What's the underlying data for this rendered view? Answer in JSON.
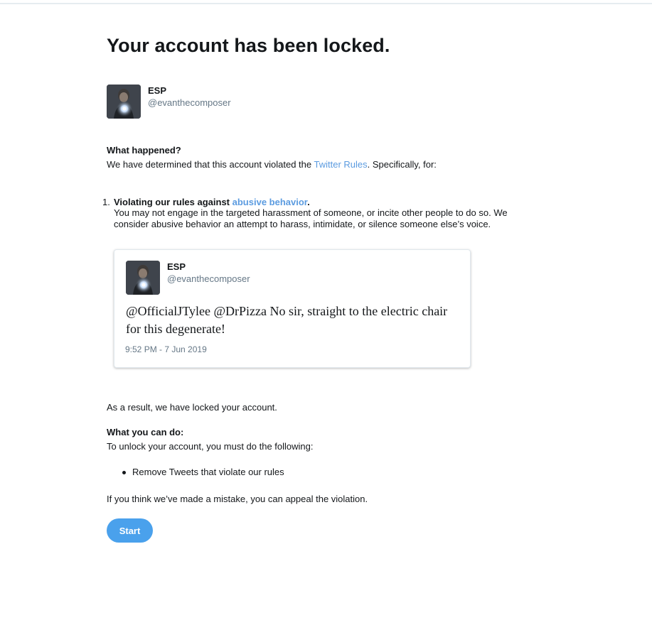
{
  "page": {
    "title": "Your account has been locked."
  },
  "account": {
    "name": "ESP",
    "handle": "@evanthecomposer"
  },
  "what_happened": {
    "heading": "What happened?",
    "text_before_link": "We have determined that this account violated the ",
    "rules_link": "Twitter Rules",
    "text_after_link": ". Specifically, for:"
  },
  "violations": [
    {
      "number": "1.",
      "title_prefix": "Violating our rules against ",
      "title_link": "abusive behavior",
      "title_suffix": ".",
      "description": "You may not engage in the targeted harassment of someone, or incite other people to do so. We consider abusive behavior an attempt to harass, intimidate, or silence someone else’s voice."
    }
  ],
  "tweet": {
    "author_name": "ESP",
    "author_handle": "@evanthecomposer",
    "text": "@OfficialJTylee @DrPizza No sir, straight to the electric chair for this degenerate!",
    "timestamp": "9:52 PM - 7 Jun 2019"
  },
  "result": {
    "text": "As a result, we have locked your account."
  },
  "what_you_can_do": {
    "heading": "What you can do:",
    "text": "To unlock your account, you must do the following:",
    "steps": [
      "Remove Tweets that violate our rules"
    ]
  },
  "appeal": {
    "text": "If you think we’ve made a mistake, you can appeal the violation."
  },
  "actions": {
    "start_label": "Start"
  },
  "colors": {
    "accent": "#4aa1ec",
    "link": "#5b9be0",
    "text": "#14171a",
    "secondary_text": "#657786"
  }
}
